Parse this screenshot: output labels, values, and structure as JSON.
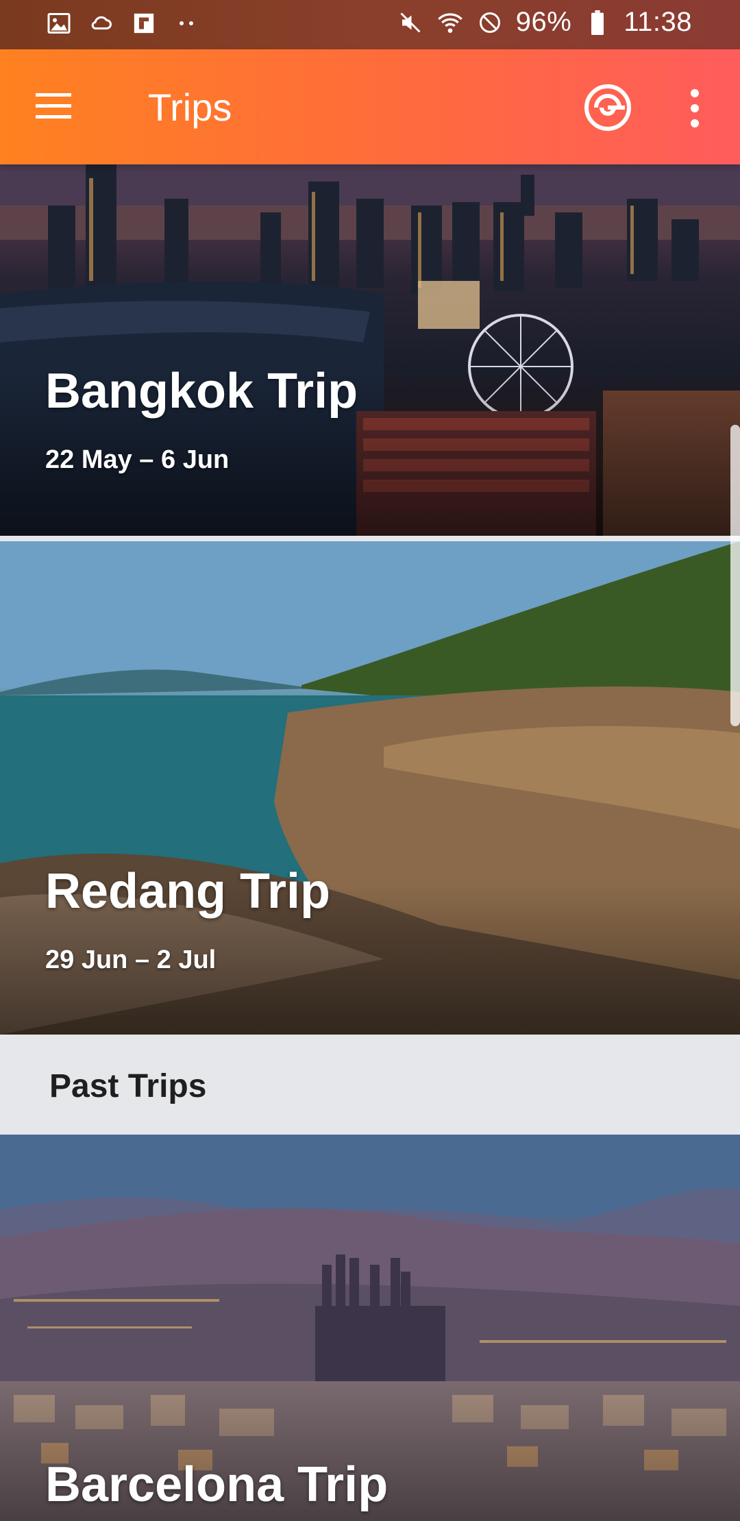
{
  "status_bar": {
    "left_icons": [
      "image-icon",
      "cloud-notification-icon",
      "flipboard-icon",
      "more-dots-icon"
    ],
    "battery": "96%",
    "time": "11:38",
    "right_icons": [
      "mute-icon",
      "wifi-icon",
      "do-not-disturb-icon",
      "battery-icon"
    ]
  },
  "app_bar": {
    "title": "Trips",
    "menu_icon": "hamburger-menu-icon",
    "action_icon": "target-icon",
    "overflow_icon": "vertical-ellipsis-icon",
    "gradient_start": "#ff8120",
    "gradient_end": "#ff5c5c"
  },
  "upcoming_trips": [
    {
      "title": "Bangkok Trip",
      "dates": "22 May – 6 Jun"
    },
    {
      "title": "Redang Trip",
      "dates": "29 Jun – 2 Jul"
    }
  ],
  "past_trips": {
    "header": "Past Trips",
    "items": [
      {
        "title": "Barcelona Trip"
      }
    ]
  }
}
